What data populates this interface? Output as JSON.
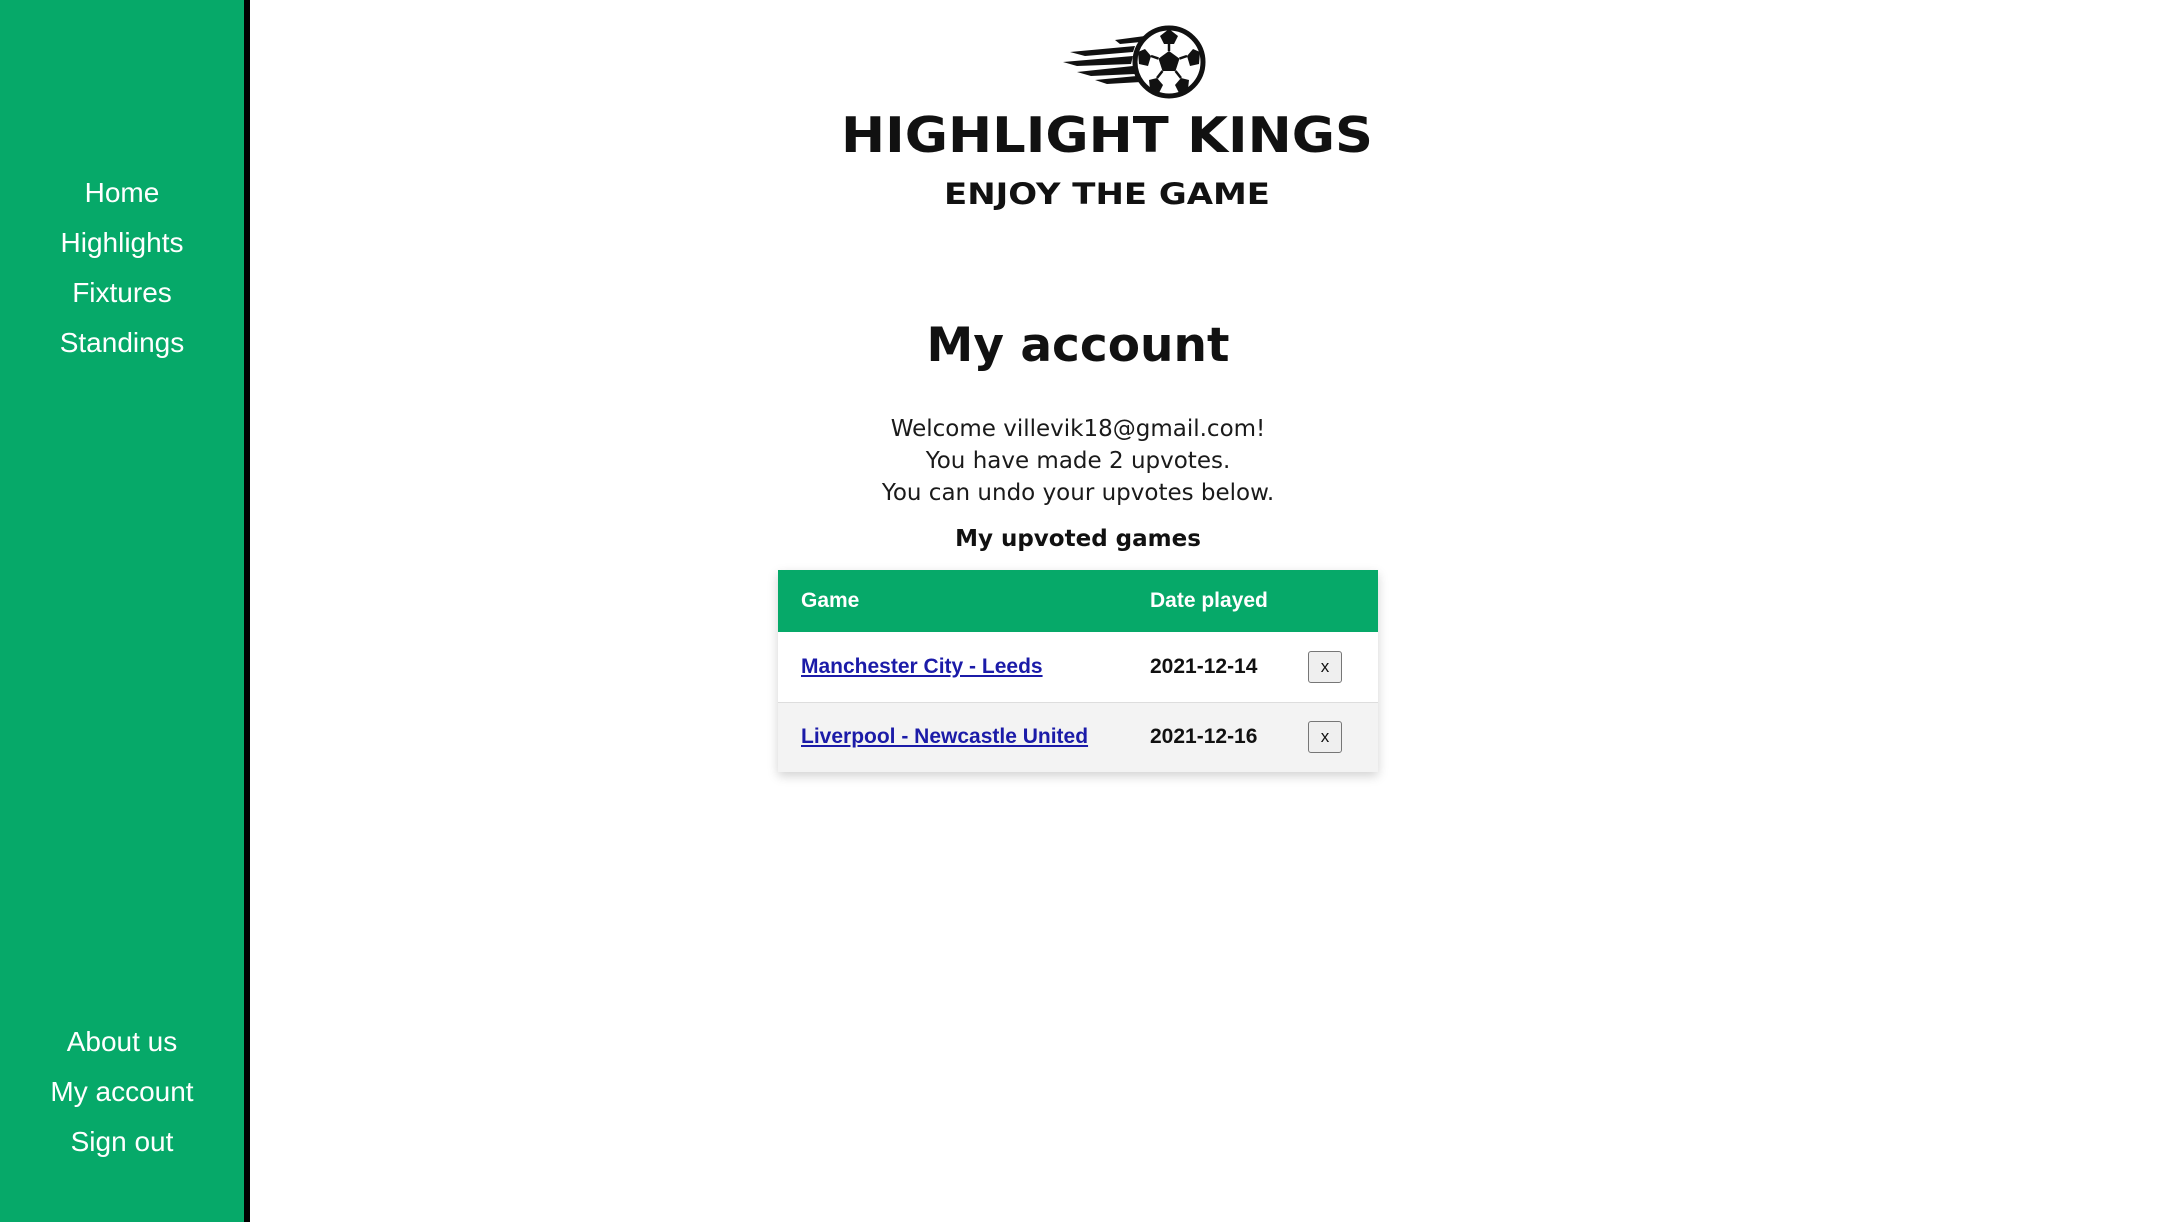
{
  "sidebar": {
    "top_items": [
      {
        "label": "Home"
      },
      {
        "label": "Highlights"
      },
      {
        "label": "Fixtures"
      },
      {
        "label": "Standings"
      }
    ],
    "bottom_items": [
      {
        "label": "About us"
      },
      {
        "label": "My account"
      },
      {
        "label": "Sign out"
      }
    ],
    "color": "#06a969"
  },
  "logo": {
    "title": "HIGHLIGHT KINGS",
    "tagline": "ENJOY THE GAME",
    "icon": "soccer-ball-icon"
  },
  "page": {
    "title": "My account",
    "welcome_line1": "Welcome villevik18@gmail.com!",
    "welcome_line2": "You have made 2 upvotes.",
    "welcome_line3": "You can undo your upvotes below.",
    "table_caption": "My upvoted games"
  },
  "table": {
    "headers": {
      "game": "Game",
      "date": "Date played"
    },
    "rows": [
      {
        "game": "Manchester City - Leeds",
        "date": "2021-12-14",
        "remove_label": "x"
      },
      {
        "game": "Liverpool - Newcastle United",
        "date": "2021-12-16",
        "remove_label": "x"
      }
    ]
  }
}
